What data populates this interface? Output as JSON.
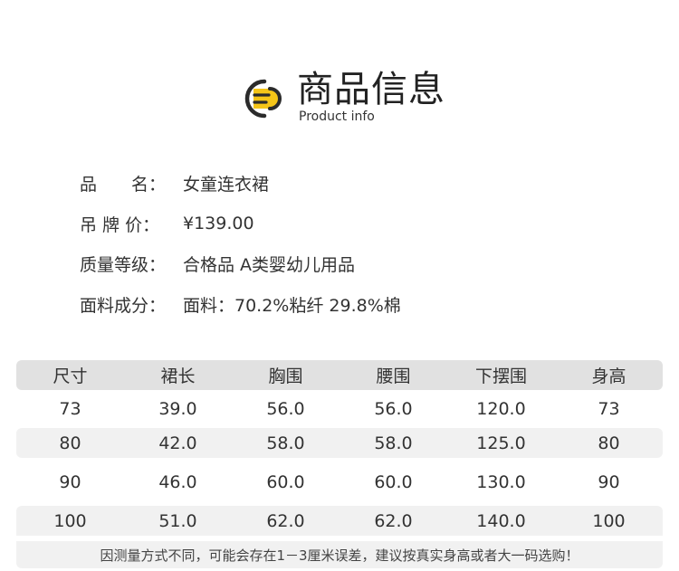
{
  "header": {
    "title": "商品信息",
    "subtitle": "Product info"
  },
  "info": [
    {
      "label": "品　　名：",
      "value": "女童连衣裙"
    },
    {
      "label": "吊 牌 价：",
      "value": "¥139.00"
    },
    {
      "label": "质量等级：",
      "value": "合格品 A类婴幼儿用品"
    },
    {
      "label": "面料成分：",
      "value": "面料：70.2%粘纤 29.8%棉"
    }
  ],
  "table": {
    "headers": [
      "尺寸",
      "裙长",
      "胸围",
      "腰围",
      "下摆围",
      "身高"
    ],
    "rows": [
      [
        "73",
        "39.0",
        "56.0",
        "56.0",
        "120.0",
        "73"
      ],
      [
        "80",
        "42.0",
        "58.0",
        "58.0",
        "125.0",
        "80"
      ],
      [
        "90",
        "46.0",
        "60.0",
        "60.0",
        "130.0",
        "90"
      ],
      [
        "100",
        "51.0",
        "62.0",
        "62.0",
        "140.0",
        "100"
      ]
    ],
    "note": "因测量方式不同，可能会存在1－3厘米误差，建议按真实身高或者大一码选购！"
  },
  "colors": {
    "accent": "#f5c518",
    "dark": "#2b2b2b",
    "row_shade": "#f1f1f1",
    "header_shade": "#e1e1e1"
  },
  "icons": {
    "logo": "document-lines-icon"
  }
}
